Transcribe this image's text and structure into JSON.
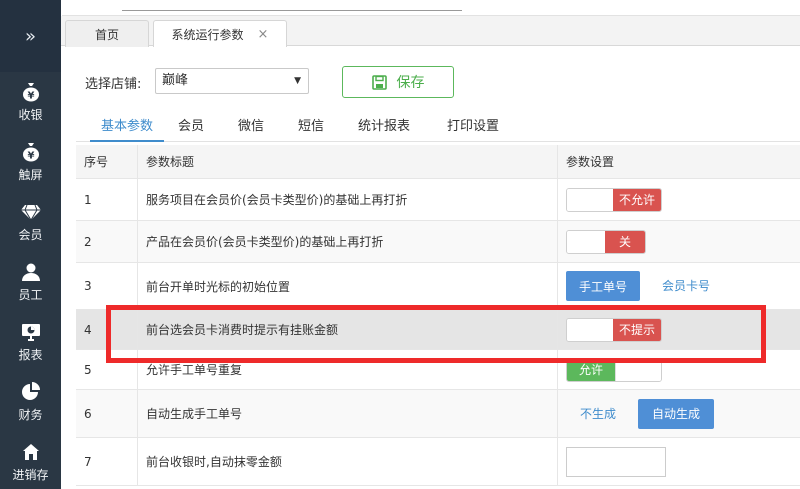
{
  "sidebar": {
    "items": [
      {
        "label": "收银",
        "icon": "yen-bag-icon"
      },
      {
        "label": "触屏",
        "icon": "yen-bag-icon"
      },
      {
        "label": "会员",
        "icon": "diamond-icon"
      },
      {
        "label": "员工",
        "icon": "user-icon"
      },
      {
        "label": "报表",
        "icon": "monitor-chart-icon"
      },
      {
        "label": "财务",
        "icon": "pie-chart-icon"
      },
      {
        "label": "进销存",
        "icon": "house-icon"
      }
    ]
  },
  "tabs": {
    "home": "首页",
    "active": "系统运行参数",
    "close": "×"
  },
  "toolbar": {
    "store_label": "选择店铺:",
    "store_value": "巅峰",
    "save_label": "保存"
  },
  "subtabs": [
    "基本参数",
    "会员",
    "微信",
    "短信",
    "统计报表",
    "打印设置"
  ],
  "table": {
    "headers": [
      "序号",
      "参数标题",
      "参数设置"
    ],
    "rows": [
      {
        "no": "1",
        "title": "服务项目在会员价(会员卡类型价)的基础上再打折",
        "control": "switch-off",
        "value": "不允许"
      },
      {
        "no": "2",
        "title": "产品在会员价(会员卡类型价)的基础上再打折",
        "control": "switch-off",
        "value": "关"
      },
      {
        "no": "3",
        "title": "前台开单时光标的初始位置",
        "control": "choice",
        "options": [
          "手工单号",
          "会员卡号"
        ],
        "selected": "手工单号"
      },
      {
        "no": "4",
        "title": "前台选会员卡消费时提示有挂账金额",
        "control": "switch-off",
        "value": "不提示"
      },
      {
        "no": "5",
        "title": "允许手工单号重复",
        "control": "switch-on",
        "value": "允许"
      },
      {
        "no": "6",
        "title": "自动生成手工单号",
        "control": "choice",
        "options": [
          "不生成",
          "自动生成"
        ],
        "selected": "自动生成"
      },
      {
        "no": "7",
        "title": "前台收银时,自动抹零金额",
        "control": "input",
        "value": ""
      }
    ]
  },
  "colors": {
    "sidebar_bg": "#2a3744",
    "accent_blue": "#4f8fd6",
    "off_red": "#d9534f",
    "on_green": "#5cb85c",
    "highlight_box": "#ee2a2a"
  }
}
